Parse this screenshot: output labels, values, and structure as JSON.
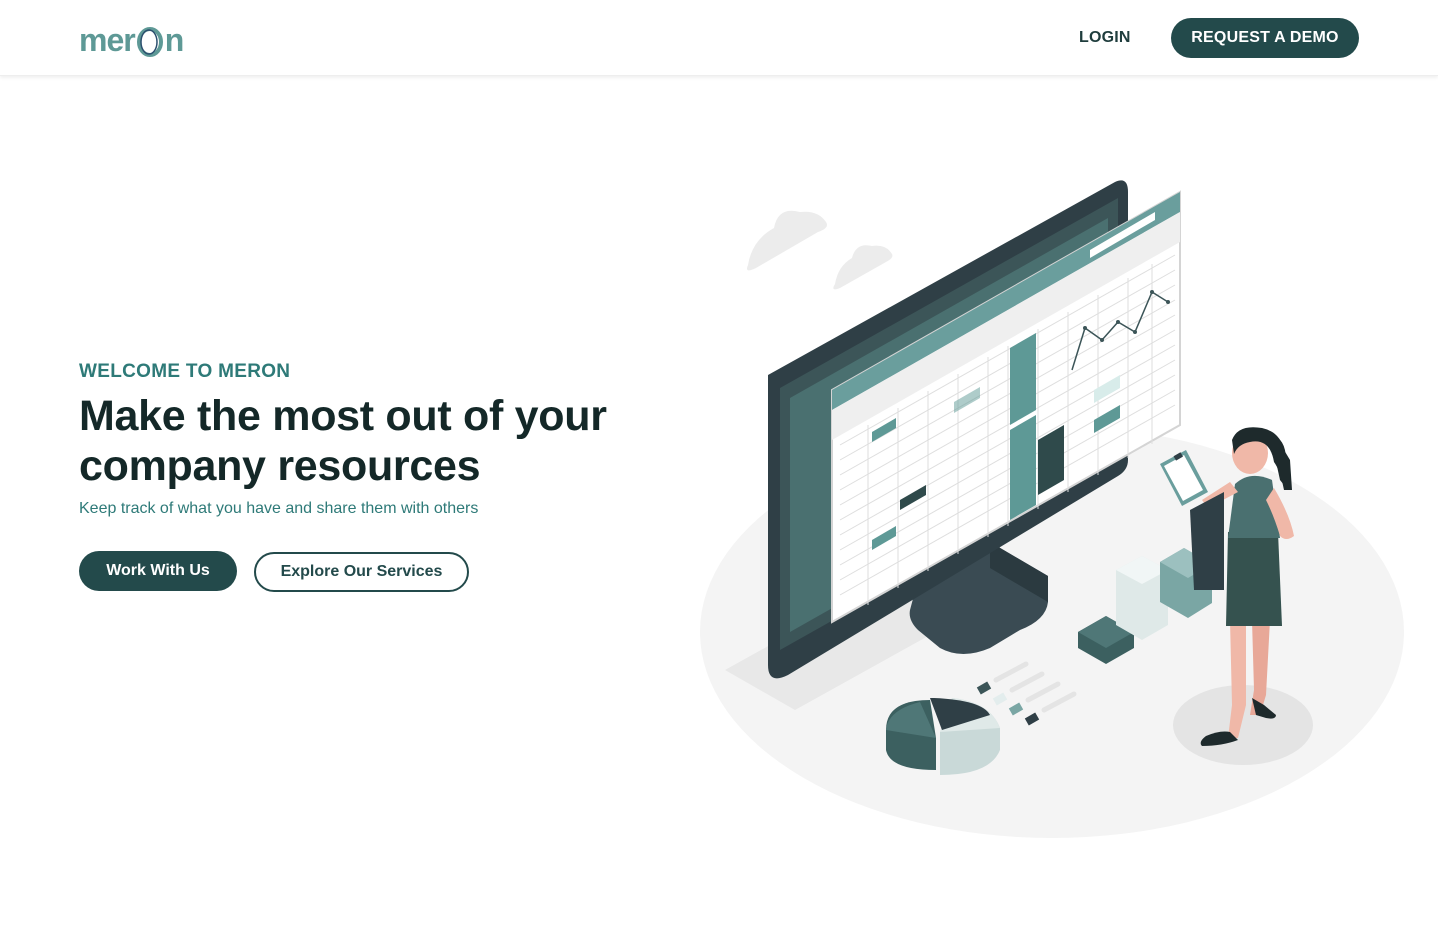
{
  "header": {
    "logo_prefix": "mer",
    "logo_suffix": "n",
    "login_label": "LOGIN",
    "demo_label": "REQUEST A DEMO"
  },
  "hero": {
    "eyebrow": "WELCOME TO MERON",
    "title_line1": "Make the most out of your",
    "title_line2": "company resources",
    "subtitle": "Keep track of what you have and share them with others",
    "primary_cta": "Work With Us",
    "secondary_cta": "Explore Our Services"
  },
  "colors": {
    "brand_dark": "#234a4b",
    "brand_teal": "#2e7a78",
    "logo_teal": "#5e9996",
    "heading": "#142828"
  },
  "illustration": {
    "icon": "dashboard-monitor-illustration"
  }
}
